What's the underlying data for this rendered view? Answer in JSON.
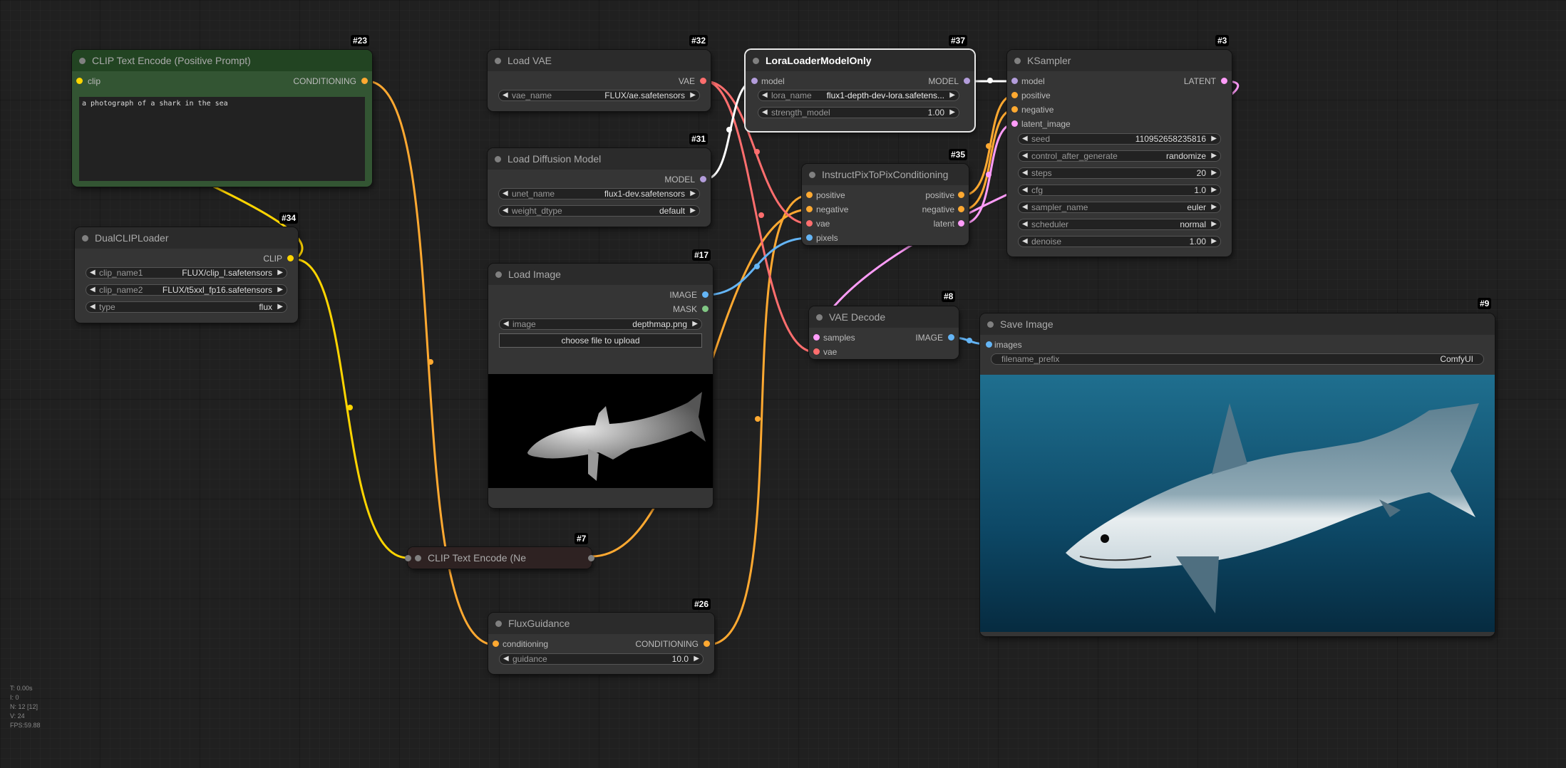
{
  "nodes": {
    "clip_text_pos": {
      "id": "#23",
      "title": "CLIP Text Encode (Positive Prompt)",
      "input": "clip",
      "output": "CONDITIONING",
      "text": "a photograph of a shark in the sea"
    },
    "dual_clip": {
      "id": "#34",
      "title": "DualCLIPLoader",
      "output": "CLIP",
      "widgets": [
        {
          "label": "clip_name1",
          "value": "FLUX/clip_l.safetensors"
        },
        {
          "label": "clip_name2",
          "value": "FLUX/t5xxl_fp16.safetensors"
        },
        {
          "label": "type",
          "value": "flux"
        }
      ]
    },
    "load_vae": {
      "id": "#32",
      "title": "Load VAE",
      "output": "VAE",
      "widgets": [
        {
          "label": "vae_name",
          "value": "FLUX/ae.safetensors"
        }
      ]
    },
    "load_diffusion": {
      "id": "#31",
      "title": "Load Diffusion Model",
      "output": "MODEL",
      "widgets": [
        {
          "label": "unet_name",
          "value": "flux1-dev.safetensors"
        },
        {
          "label": "weight_dtype",
          "value": "default"
        }
      ]
    },
    "load_image": {
      "id": "#17",
      "title": "Load Image",
      "outputs": [
        "IMAGE",
        "MASK"
      ],
      "widgets": [
        {
          "label": "image",
          "value": "depthmap.png"
        }
      ],
      "upload_button": "choose file to upload"
    },
    "clip_text_neg": {
      "id": "#7",
      "title": "CLIP Text Encode (Ne"
    },
    "flux_guidance": {
      "id": "#26",
      "title": "FluxGuidance",
      "input": "conditioning",
      "output": "CONDITIONING",
      "widgets": [
        {
          "label": "guidance",
          "value": "10.0"
        }
      ]
    },
    "lora": {
      "id": "#37",
      "title": "LoraLoaderModelOnly",
      "input": "model",
      "output": "MODEL",
      "widgets": [
        {
          "label": "lora_name",
          "value": "flux1-depth-dev-lora.safetens..."
        },
        {
          "label": "strength_model",
          "value": "1.00"
        }
      ]
    },
    "instruct_pix": {
      "id": "#35",
      "title": "InstructPixToPixConditioning",
      "inputs": [
        "positive",
        "negative",
        "vae",
        "pixels"
      ],
      "outputs": [
        "positive",
        "negative",
        "latent"
      ]
    },
    "ksampler": {
      "id": "#3",
      "title": "KSampler",
      "inputs": [
        "model",
        "positive",
        "negative",
        "latent_image"
      ],
      "output": "LATENT",
      "widgets": [
        {
          "label": "seed",
          "value": "110952658235816"
        },
        {
          "label": "control_after_generate",
          "value": "randomize"
        },
        {
          "label": "steps",
          "value": "20"
        },
        {
          "label": "cfg",
          "value": "1.0"
        },
        {
          "label": "sampler_name",
          "value": "euler"
        },
        {
          "label": "scheduler",
          "value": "normal"
        },
        {
          "label": "denoise",
          "value": "1.00"
        }
      ]
    },
    "vae_decode": {
      "id": "#8",
      "title": "VAE Decode",
      "inputs": [
        "samples",
        "vae"
      ],
      "output": "IMAGE"
    },
    "save_image": {
      "id": "#9",
      "title": "Save Image",
      "input": "images",
      "widgets": [
        {
          "label": "filename_prefix",
          "value": "ComfyUI"
        }
      ]
    }
  },
  "stats": [
    "T: 0.00s",
    "I: 0",
    "N: 12 [12]",
    "V: 24",
    "FPS:59.88"
  ],
  "colors": {
    "clip": "#ffd500",
    "conditioning": "#ffa931",
    "vae": "#ff6e6e",
    "model": "#b39ddb",
    "image": "#64b5f6",
    "latent": "#ff9cf9",
    "mask": "#81c784"
  }
}
